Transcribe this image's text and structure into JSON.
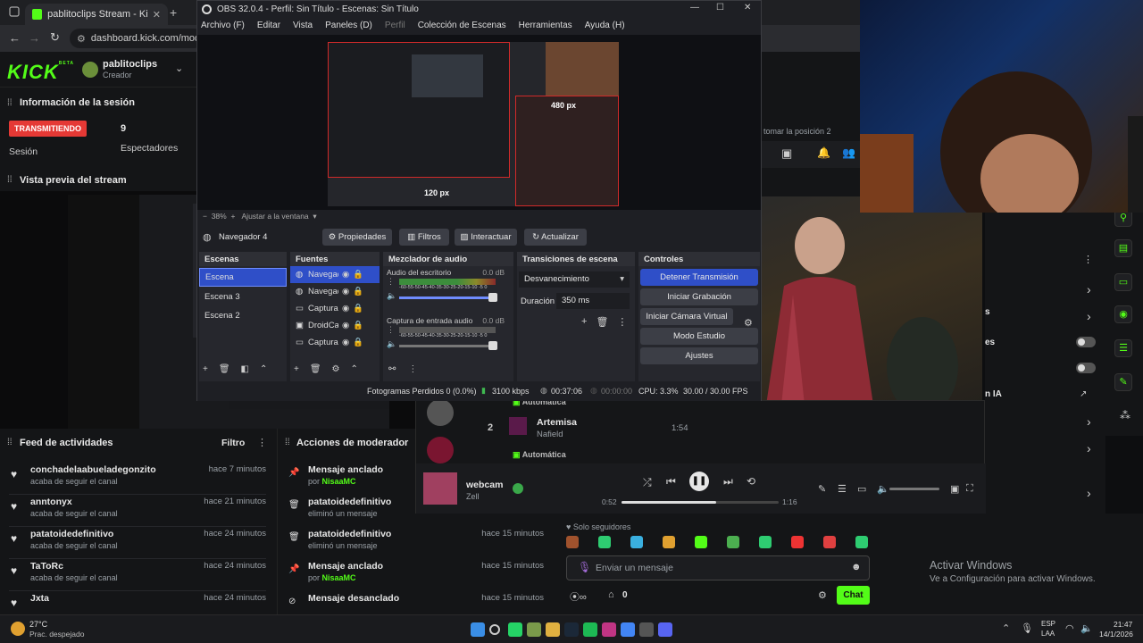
{
  "browser": {
    "tab1": "pablitoclips Stream - Kick Dashb",
    "url": "dashboard.kick.com/moder"
  },
  "kick": {
    "logo": "KICK",
    "logo_badge": "BETA",
    "username": "pablitoclips",
    "role": "Creador",
    "session_title": "Información de la sesión",
    "live_badge": "TRANSMITIENDO",
    "session_label": "Sesión",
    "viewers_count": "9",
    "viewers_label": "Espectadores",
    "preview_title": "Vista previa del stream",
    "activity_title": "Feed de actividades",
    "filter_label": "Filtro",
    "mod_title": "Acciones de moderador"
  },
  "activity": [
    {
      "name": "conchadelaabueladegonzito",
      "sub": "acaba de seguir el canal",
      "time": "hace 7 minutos"
    },
    {
      "name": "anntonyx",
      "sub": "acaba de seguir el canal",
      "time": "hace 21 minutos"
    },
    {
      "name": "patatoidedefinitivo",
      "sub": "acaba de seguir el canal",
      "time": "hace 24 minutos"
    },
    {
      "name": "TaToRc",
      "sub": "acaba de seguir el canal",
      "time": "hace 24 minutos"
    },
    {
      "name": "Jxta",
      "sub": "",
      "time": "hace 24 minutos"
    }
  ],
  "modactions": [
    {
      "name": "Mensaje anclado",
      "sub": "por ",
      "by": "NisaaMC",
      "time": ""
    },
    {
      "name": "patatoidedefinitivo",
      "sub": "eliminó un mensaje",
      "by": "",
      "time": ""
    },
    {
      "name": "patatoidedefinitivo",
      "sub": "eliminó un mensaje",
      "by": "",
      "time": "hace 15 minutos"
    },
    {
      "name": "Mensaje anclado",
      "sub": "por ",
      "by": "NisaaMC",
      "time": "hace 15 minutos"
    },
    {
      "name": "Mensaje desanclado",
      "sub": "",
      "by": "",
      "time": "hace 15 minutos"
    }
  ],
  "obs": {
    "title": "OBS 32.0.4 - Perfil: Sin Título - Escenas: Sin Título",
    "menu": [
      "Archivo (F)",
      "Editar",
      "Vista",
      "Paneles (D)",
      "Perfil",
      "Colección de Escenas",
      "Herramientas",
      "Ayuda (H)"
    ],
    "zoom": "38%",
    "fit": "Ajustar a la ventana",
    "px_top": "480 px",
    "px_bottom": "120 px",
    "source_name": "Navegador 4",
    "btn_props": "Propiedades",
    "btn_filters": "Filtros",
    "btn_interact": "Interactuar",
    "btn_refresh": "Actualizar",
    "scenes_title": "Escenas",
    "scenes": [
      "Escena",
      "Escena 3",
      "Escena 2"
    ],
    "sources_title": "Fuentes",
    "sources": [
      "Navegad",
      "Navegad",
      "Captura",
      "DroidCa",
      "Captura"
    ],
    "mixer_title": "Mezclador de audio",
    "mixer": [
      {
        "name": "Audio del escritorio",
        "db": "0.0 dB"
      },
      {
        "name": "Captura de entrada audio",
        "db": "0.0 dB"
      }
    ],
    "meter_scale": "-60-55-50-45-40-35-30-25-20-15-10 -5 0",
    "transitions_title": "Transiciones de escena",
    "transition": "Desvanecimiento",
    "duration_label": "Duración",
    "duration": "350 ms",
    "controls_title": "Controles",
    "controls": [
      "Detener Transmisión",
      "Iniciar Grabación",
      "Iniciar Cámara Virtual",
      "Modo Estudio",
      "Ajustes"
    ],
    "status_dropped": "Fotogramas Perdidos 0 (0.0%)",
    "status_kbps": "3100 kbps",
    "status_live": "00:37:06",
    "status_rec": "00:00:00",
    "status_cpu": "CPU: 3.3%",
    "status_fps": "30.00 / 30.00 FPS"
  },
  "player": {
    "queue_label": "Automática",
    "queue_num": "2",
    "song_title": "Artemisa",
    "song_artist": "Nafield",
    "song_duration": "1:54",
    "queue_label2": "Automática",
    "now_title": "webcam",
    "now_artist": "Zell",
    "time_current": "0:52",
    "time_total": "1:16",
    "progress": 0.6
  },
  "stream": {
    "watermark": "webcam",
    "right_text_1": "tomar la posición 2",
    "right_text_2": "s",
    "right_text_3": "es",
    "right_text_4": "n IA"
  },
  "chat": {
    "followers_only": "Solo seguidores",
    "placeholder": "Enviar un mensaje",
    "count": "0",
    "send": "Chat"
  },
  "windows": {
    "activate_title": "Activar Windows",
    "activate_sub": "Ve a Configuración para activar Windows."
  },
  "taskbar": {
    "temp": "27°C",
    "weather": "Prac. despejado",
    "lang1": "ESP",
    "lang2": "LAA",
    "time": "21:47",
    "date": "14/1/2026"
  },
  "colors": {
    "kick_green": "#53fc18",
    "obs_selected": "#2f4fc8",
    "live_red": "#e53935"
  }
}
